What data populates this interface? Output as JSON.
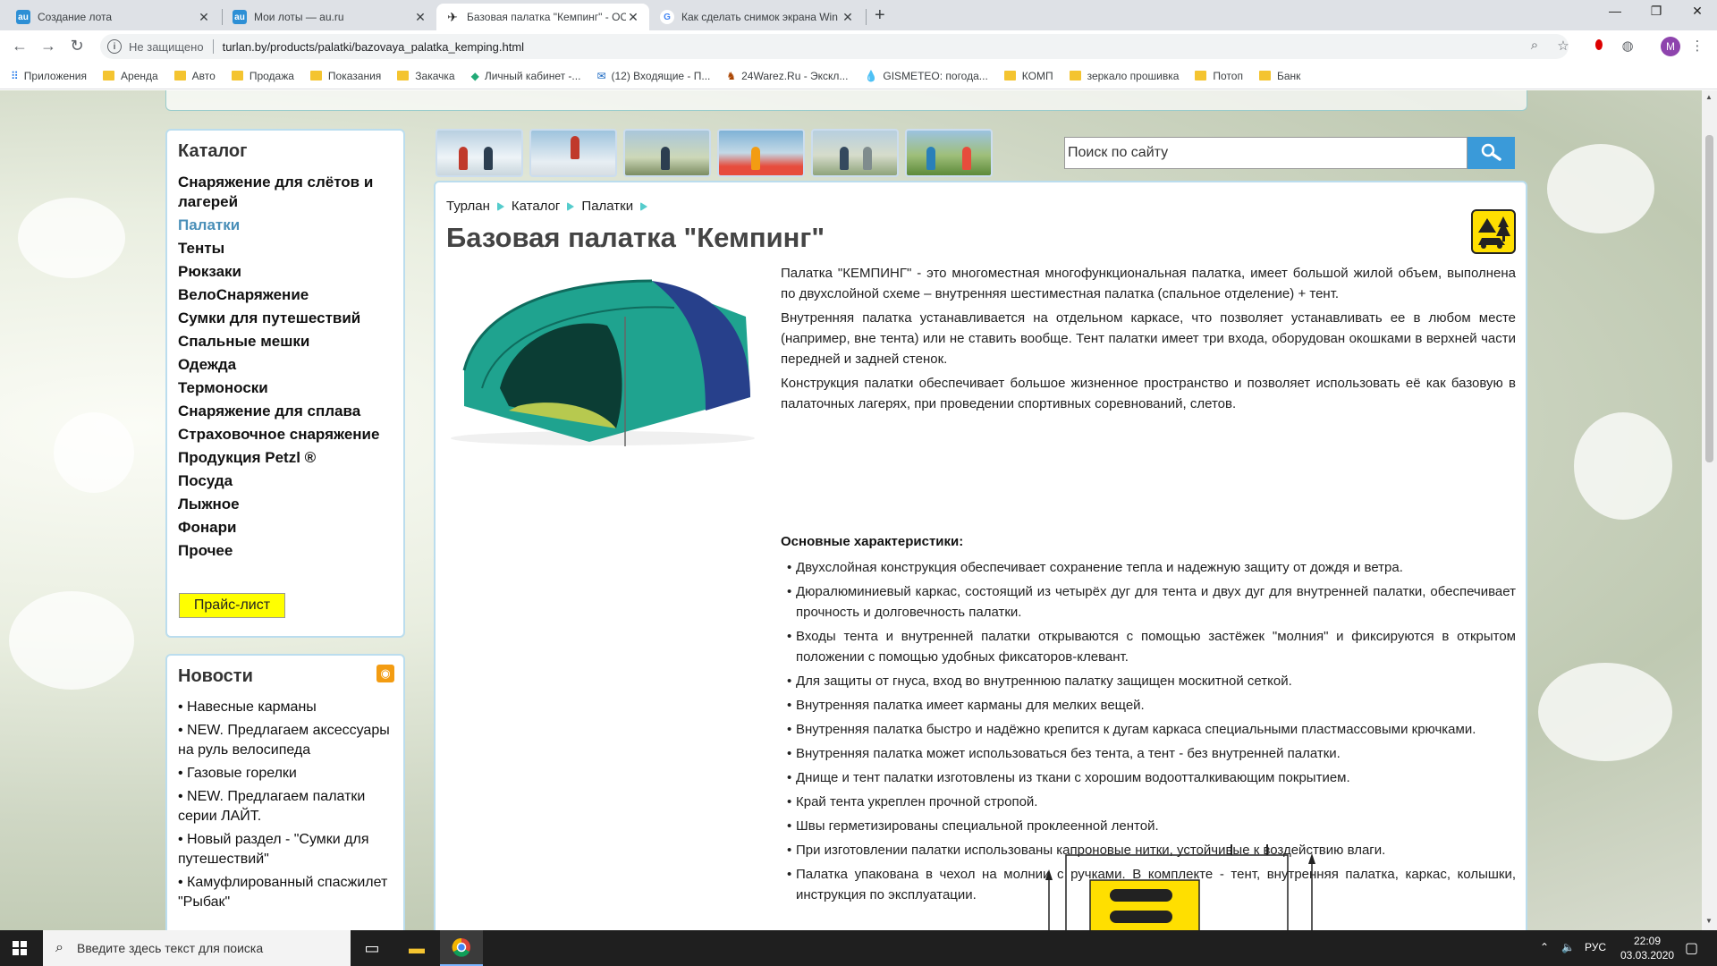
{
  "browser": {
    "tabs": [
      {
        "title": "Создание лота",
        "favicon": "au",
        "active": false
      },
      {
        "title": "Мои лоты — au.ru",
        "favicon": "au",
        "active": false
      },
      {
        "title": "Базовая палатка \"Кемпинг\" - ОО",
        "favicon": "bird",
        "active": true
      },
      {
        "title": "Как сделать снимок экрана Win",
        "favicon": "G",
        "active": false
      }
    ],
    "new_tab": "+",
    "security_label": "Не защищено",
    "url": "turlan.by/products/palatki/bazovaya_palatka_kemping.html",
    "profile_initial": "M",
    "bookmarks": [
      {
        "label": "Приложения",
        "icon": "apps-icon"
      },
      {
        "label": "Аренда",
        "icon": "folder-icon"
      },
      {
        "label": "Авто",
        "icon": "folder-icon"
      },
      {
        "label": "Продажа",
        "icon": "folder-icon"
      },
      {
        "label": "Показания",
        "icon": "folder-icon"
      },
      {
        "label": "Закачка",
        "icon": "folder-icon"
      },
      {
        "label": "Личный кабинет -...",
        "icon": "site-icon"
      },
      {
        "label": "(12) Входящие - П...",
        "icon": "mail-icon"
      },
      {
        "label": "24Warez.Ru - Экскл...",
        "icon": "site-icon"
      },
      {
        "label": "GISMETEO: погода...",
        "icon": "drop-icon"
      },
      {
        "label": "КОМП",
        "icon": "folder-icon"
      },
      {
        "label": "зеркало прошивка",
        "icon": "folder-icon"
      },
      {
        "label": "Потоп",
        "icon": "folder-icon"
      },
      {
        "label": "Банк",
        "icon": "folder-icon"
      }
    ]
  },
  "sidebar": {
    "catalog_title": "Каталог",
    "catalog_items": [
      "Снаряжение для слётов и лагерей",
      "Палатки",
      "Тенты",
      "Рюкзаки",
      "ВелоСнаряжение",
      "Сумки для путешествий",
      "Спальные мешки",
      "Одежда",
      "Термоноски",
      "Снаряжение для сплава",
      "Страховочное снаряжение",
      "Продукция Petzl ®",
      "Посуда",
      "Лыжное",
      "Фонари",
      "Прочее"
    ],
    "current_item": "Палатки",
    "price_list": "Прайс-лист",
    "news_title": "Новости",
    "news_items": [
      "• Навесные карманы",
      "• NEW. Предлагаем аксессуары на руль велосипеда",
      "• Газовые горелки",
      "• NEW. Предлагаем палатки серии ЛАЙТ.",
      "• Новый раздел - \"Сумки для путешествий\"",
      "• Камуфлированный спасжилет \"Рыбак\""
    ]
  },
  "search": {
    "value": "Поиск по сайту"
  },
  "breadcrumb": [
    "Турлан",
    "Каталог",
    "Палатки"
  ],
  "product": {
    "title": "Базовая палатка \"Кемпинг\"",
    "description": [
      "Палатка \"КЕМПИНГ\" - это многоместная многофункциональная палатка, имеет большой жилой объем, выполнена по двухслойной схеме – внутренняя шестиместная палатка (спальное отделение) + тент.",
      "Внутренняя палатка устанавливается на отдельном каркасе, что позволяет устанавливать ее в любом месте (например, вне тента) или не ставить вообще. Тент палатки имеет три входа, оборудован окошками в верхней части передней и задней стенок.",
      "Конструкция палатки обеспечивает большое жизненное пространство и позволяет использовать её как базовую в палаточных лагерях, при проведении спортивных соревнований, слетов."
    ],
    "specs_title": "Основные характеристики:",
    "specs": [
      "Двухслойная конструкция обеспечивает сохранение тепла и надежную защиту от дождя и ветра.",
      "Дюралюминиевый каркас, состоящий из четырёх дуг для тента и двух дуг для внутренней палатки, обеспечивает прочность и долговечность палатки.",
      "Входы тента и внутренней палатки открываются с помощью застёжек \"молния\" и фиксируются в открытом положении с помощью удобных фиксаторов-клевант.",
      "Для защиты от гнуса, вход во внутреннюю палатку защищен москитной сеткой.",
      "Внутренняя палатка имеет карманы для мелких вещей.",
      "Внутренняя палатка быстро и надёжно крепится к дугам каркаса специальными пластмассовыми крючками.",
      "Внутренняя палатка может использоваться без тента, а тент - без внутренней палатки.",
      "Днище и тент палатки изготовлены из ткани с хорошим водоотталкивающим покрытием.",
      "Край тента укреплен прочной стропой.",
      "Швы герметизированы специальной проклеенной лентой.",
      "При изготовлении палатки использованы капроновые нитки, устойчивые к воздействию влаги.",
      "Палатка упакована в чехол на молнии с ручками. В комплекте - тент, внутренняя палатка, каркас, колышки, инструкция по эксплуатации."
    ]
  },
  "taskbar": {
    "search_placeholder": "Введите здесь текст для поиска",
    "lang": "РУС",
    "time": "22:09",
    "date": "03.03.2020"
  },
  "colors": {
    "accent": "#3a9ad9",
    "current_link": "#4a8fb8",
    "price_button": "#ffff00",
    "panel_border": "#bbddee"
  }
}
